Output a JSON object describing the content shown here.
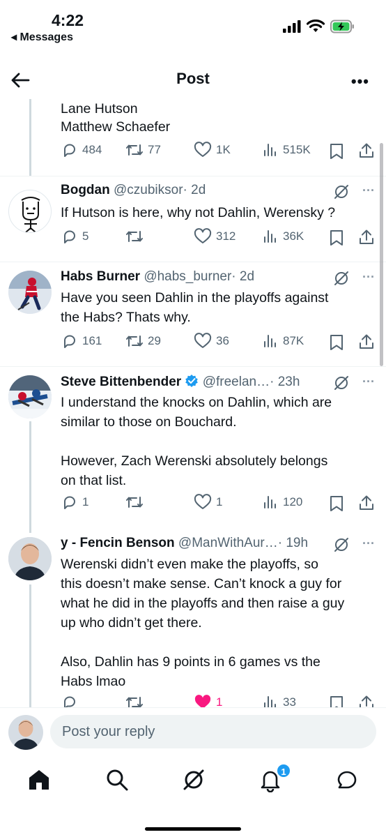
{
  "status_bar": {
    "time": "4:22",
    "back_app": "◂ Messages"
  },
  "header": {
    "title": "Post"
  },
  "top_post": {
    "text_lines": [
      "Lane Hutson",
      "Matthew Schaefer"
    ],
    "replies": "484",
    "reposts": "77",
    "likes": "1K",
    "views": "515K"
  },
  "replies": [
    {
      "name": "Bogdan",
      "handle": "@czubiksor",
      "time": "· 2d",
      "text": "If Hutson is here, why not Dahlin, Werensky ?",
      "replies": "5",
      "reposts": "",
      "likes": "312",
      "views": "36K"
    },
    {
      "name": "Habs Burner",
      "handle": "@habs_burner",
      "time": "· 2d",
      "text": "Have you seen Dahlin in the playoffs against\nthe Habs? Thats why.",
      "replies": "161",
      "reposts": "29",
      "likes": "36",
      "views": "87K"
    },
    {
      "name": "Steve Bittenbender",
      "handle": "@freelan…",
      "time": "· 23h",
      "verified": true,
      "text": "I understand the knocks on Dahlin, which are\nsimilar to those on Bouchard.\n\nHowever, Zach Werenski absolutely belongs\non that list.",
      "replies": "1",
      "reposts": "",
      "likes": "1",
      "views": "120"
    },
    {
      "name": "y - Fencin Benson",
      "handle": "@ManWithAur…",
      "time": "· 19h",
      "text": "Werenski didn’t even make the playoffs, so\nthis doesn’t make sense. Can’t knock a guy for\nwhat he did in the playoffs and then raise a guy\nup who didn’t get there.\n\nAlso, Dahlin has 9 points in 6 games vs the\nHabs lmao",
      "replies": "",
      "reposts": "",
      "likes": "1",
      "views": "33",
      "liked": true
    }
  ],
  "reply_bar": {
    "placeholder": "Post your reply"
  },
  "tabs": {
    "notifications_badge": "1"
  },
  "colors": {
    "accent": "#1d9bf0",
    "like": "#f91880",
    "text": "#0f1419",
    "muted": "#536471",
    "thread_line": "#cfd9de"
  },
  "icons": [
    "back-arrow-icon",
    "more-icon",
    "reply-icon",
    "repost-icon",
    "like-icon",
    "views-icon",
    "bookmark-icon",
    "share-icon",
    "grok-icon",
    "verified-icon",
    "home-icon",
    "search-icon",
    "notifications-icon",
    "messages-icon"
  ]
}
